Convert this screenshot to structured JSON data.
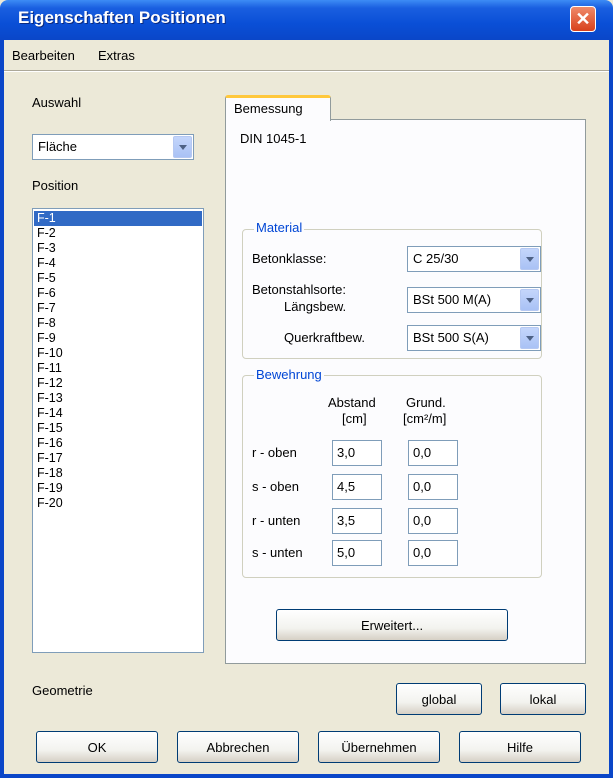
{
  "window": {
    "title": "Eigenschaften Positionen",
    "close_label": "✕"
  },
  "menu": [
    {
      "label": "Bearbeiten"
    },
    {
      "label": "Extras"
    }
  ],
  "left": {
    "auswahl_label": "Auswahl",
    "auswahl_value": "Fläche",
    "position_label": "Position",
    "positions": [
      "F-1",
      "F-2",
      "F-3",
      "F-4",
      "F-5",
      "F-6",
      "F-7",
      "F-8",
      "F-9",
      "F-10",
      "F-11",
      "F-12",
      "F-13",
      "F-14",
      "F-15",
      "F-16",
      "F-17",
      "F-18",
      "F-19",
      "F-20"
    ],
    "selected_index": 0
  },
  "tab": {
    "label": "Bemessung",
    "norm": "DIN 1045-1",
    "material": {
      "title": "Material",
      "betonklasse_label": "Betonklasse:",
      "betonklasse_value": "C 25/30",
      "betonstahlsorte_label": "Betonstahlsorte:",
      "laengsbew_label": "Längsbew.",
      "laengsbew_value": "BSt 500 M(A)",
      "querkraftbew_label": "Querkraftbew.",
      "querkraftbew_value": "BSt 500 S(A)"
    },
    "bewehrung": {
      "title": "Bewehrung",
      "col1_header": "Abstand",
      "col1_unit": "[cm]",
      "col2_header": "Grund.",
      "col2_unit": "[cm²/m]",
      "rows": [
        {
          "label": "r - oben",
          "abstand": "3,0",
          "grund": "0,0"
        },
        {
          "label": "s - oben",
          "abstand": "4,5",
          "grund": "0,0"
        },
        {
          "label": "r - unten",
          "abstand": "3,5",
          "grund": "0,0"
        },
        {
          "label": "s - unten",
          "abstand": "5,0",
          "grund": "0,0"
        }
      ]
    },
    "erweitert_label": "Erweitert..."
  },
  "geometrie": {
    "label": "Geometrie",
    "global_label": "global",
    "lokal_label": "lokal"
  },
  "buttons": {
    "ok": "OK",
    "abbrechen": "Abbrechen",
    "uebernehmen": "Übernehmen",
    "hilfe": "Hilfe"
  },
  "colors": {
    "titlebar": "#0a46c8",
    "selection": "#316ac5",
    "group_title": "#0046d5",
    "tab_accent": "#ffc83c"
  }
}
